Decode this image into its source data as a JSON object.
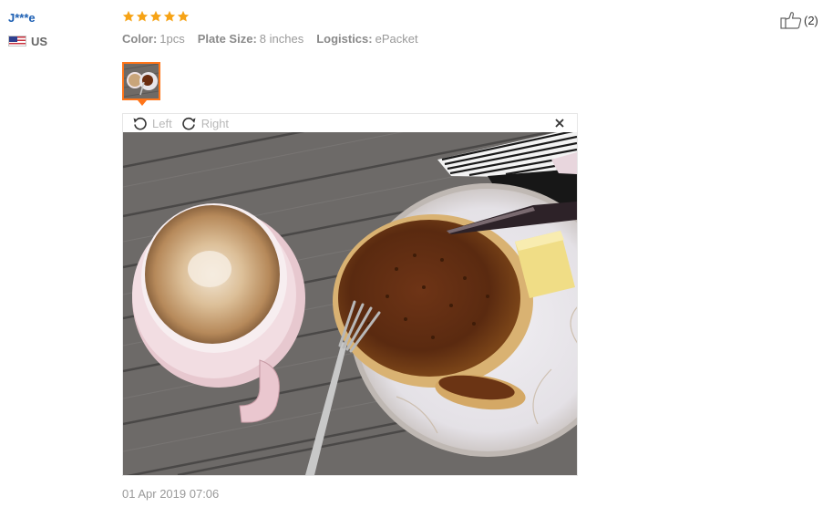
{
  "reviewer": {
    "name": "J***e",
    "country_code": "US",
    "flag_icon": "us-flag-icon"
  },
  "feedback": {
    "rating": 5,
    "rating_max": 5,
    "star_color": "#f6a316",
    "attributes": [
      {
        "key": "Color:",
        "value": "1pcs"
      },
      {
        "key": "Plate Size:",
        "value": "8 inches"
      },
      {
        "key": "Logistics:",
        "value": "ePacket"
      }
    ],
    "date": "01 Apr 2019 07:06"
  },
  "viewer": {
    "rotate_left_label": "Left",
    "rotate_right_label": "Right",
    "rotate_left_icon": "rotate-left-icon",
    "rotate_right_icon": "rotate-right-icon",
    "close_icon": "close-icon"
  },
  "helpful": {
    "count": "(2)",
    "icon": "thumbs-up-icon"
  },
  "colors": {
    "reviewer_name": "#1c5fb3",
    "thumb_border": "#ff7519"
  }
}
